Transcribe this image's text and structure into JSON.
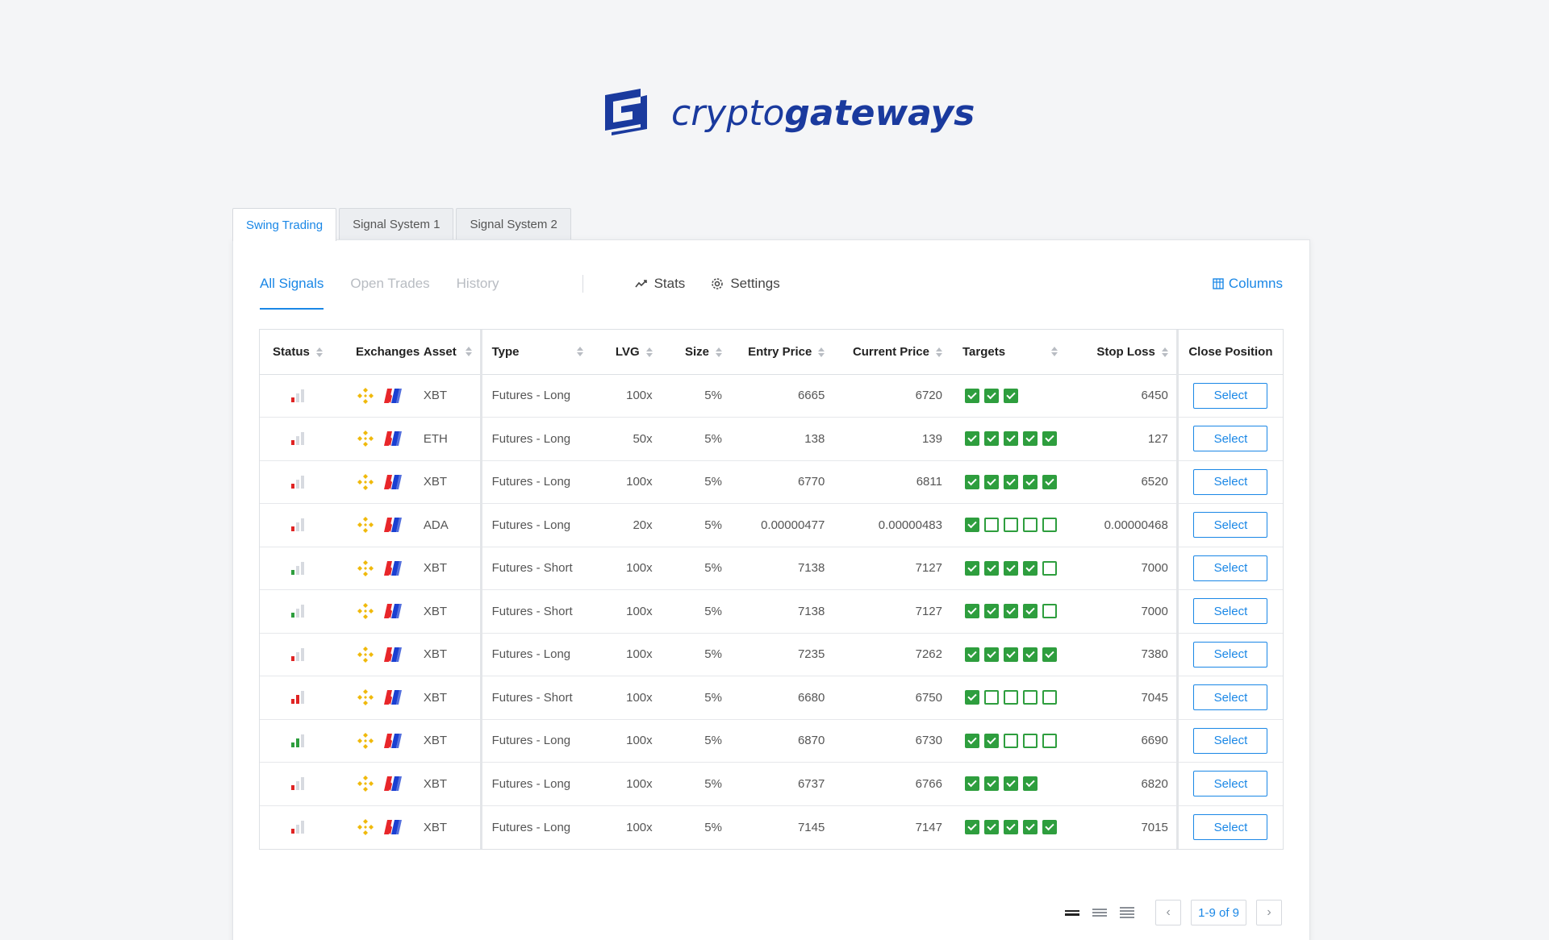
{
  "brand": {
    "name_light": "crypto",
    "name_bold": "gateways",
    "color": "#1a3a9e"
  },
  "tabs": [
    {
      "label": "Swing Trading",
      "active": true
    },
    {
      "label": "Signal System 1",
      "active": false
    },
    {
      "label": "Signal System 2",
      "active": false
    }
  ],
  "subnav": {
    "links": [
      "All Signals",
      "Open Trades",
      "History"
    ],
    "stats_label": "Stats",
    "settings_label": "Settings",
    "columns_label": "Columns"
  },
  "table": {
    "headers": {
      "status": "Status",
      "exchanges": "Exchanges",
      "asset": "Asset",
      "type": "Type",
      "lvg": "LVG",
      "size": "Size",
      "entry": "Entry Price",
      "current": "Current Price",
      "targets": "Targets",
      "stop": "Stop Loss",
      "close": "Close Position"
    },
    "select_label": "Select",
    "rows": [
      {
        "status_level": 1,
        "status_color": "red",
        "asset": "XBT",
        "type": "Futures - Long",
        "lvg": "100x",
        "size": "5%",
        "entry": "6665",
        "current": "6720",
        "targets": [
          1,
          1,
          1
        ],
        "stop": "6450"
      },
      {
        "status_level": 1,
        "status_color": "red",
        "asset": "ETH",
        "type": "Futures - Long",
        "lvg": "50x",
        "size": "5%",
        "entry": "138",
        "current": "139",
        "targets": [
          1,
          1,
          1,
          1,
          1
        ],
        "stop": "127"
      },
      {
        "status_level": 1,
        "status_color": "red",
        "asset": "XBT",
        "type": "Futures - Long",
        "lvg": "100x",
        "size": "5%",
        "entry": "6770",
        "current": "6811",
        "targets": [
          1,
          1,
          1,
          1,
          1
        ],
        "stop": "6520"
      },
      {
        "status_level": 1,
        "status_color": "red",
        "asset": "ADA",
        "type": "Futures - Long",
        "lvg": "20x",
        "size": "5%",
        "entry": "0.00000477",
        "current": "0.00000483",
        "targets": [
          1,
          0,
          0,
          0,
          0
        ],
        "stop": "0.00000468"
      },
      {
        "status_level": 1,
        "status_color": "green",
        "asset": "XBT",
        "type": "Futures - Short",
        "lvg": "100x",
        "size": "5%",
        "entry": "7138",
        "current": "7127",
        "targets": [
          1,
          1,
          1,
          1,
          0
        ],
        "stop": "7000"
      },
      {
        "status_level": 1,
        "status_color": "green",
        "asset": "XBT",
        "type": "Futures - Short",
        "lvg": "100x",
        "size": "5%",
        "entry": "7138",
        "current": "7127",
        "targets": [
          1,
          1,
          1,
          1,
          0
        ],
        "stop": "7000"
      },
      {
        "status_level": 1,
        "status_color": "red",
        "asset": "XBT",
        "type": "Futures - Long",
        "lvg": "100x",
        "size": "5%",
        "entry": "7235",
        "current": "7262",
        "targets": [
          1,
          1,
          1,
          1,
          1
        ],
        "stop": "7380"
      },
      {
        "status_level": 2,
        "status_color": "red",
        "asset": "XBT",
        "type": "Futures - Short",
        "lvg": "100x",
        "size": "5%",
        "entry": "6680",
        "current": "6750",
        "targets": [
          1,
          0,
          0,
          0,
          0
        ],
        "stop": "7045"
      },
      {
        "status_level": 2,
        "status_color": "green",
        "asset": "XBT",
        "type": "Futures - Long",
        "lvg": "100x",
        "size": "5%",
        "entry": "6870",
        "current": "6730",
        "targets": [
          1,
          1,
          0,
          0,
          0
        ],
        "stop": "6690"
      },
      {
        "status_level": 1,
        "status_color": "red",
        "asset": "XBT",
        "type": "Futures - Long",
        "lvg": "100x",
        "size": "5%",
        "entry": "6737",
        "current": "6766",
        "targets": [
          1,
          1,
          1,
          1
        ],
        "stop": "6820"
      },
      {
        "status_level": 1,
        "status_color": "red",
        "asset": "XBT",
        "type": "Futures - Long",
        "lvg": "100x",
        "size": "5%",
        "entry": "7145",
        "current": "7147",
        "targets": [
          1,
          1,
          1,
          1,
          1
        ],
        "stop": "7015"
      }
    ]
  },
  "pagination": {
    "info": "1-9 of 9",
    "prev_icon": "chevron-left-icon",
    "next_icon": "chevron-right-icon"
  },
  "colors": {
    "accent": "#1a87e6",
    "target_green": "#2e9e3e",
    "status_red": "#e02424",
    "status_green": "#2e9e3e",
    "binance": "#f0b90b",
    "bitmex_red": "#e8262a",
    "bitmex_blue": "#1a3fd1"
  }
}
